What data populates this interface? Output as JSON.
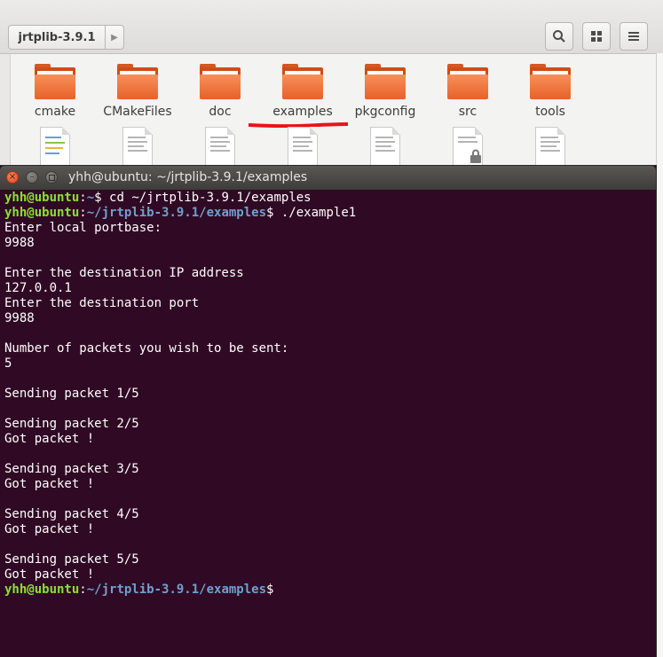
{
  "file_manager": {
    "path_label": "jrtplib-3.9.1",
    "folders": [
      {
        "name": "cmake"
      },
      {
        "name": "CMakeFiles"
      },
      {
        "name": "doc"
      },
      {
        "name": "examples"
      },
      {
        "name": "pkgconfig"
      },
      {
        "name": "src"
      },
      {
        "name": "tools"
      }
    ],
    "annotation_color": "#e8141c",
    "folder_color": "#e8612a"
  },
  "terminal": {
    "title": "yhh@ubuntu: ~/jrtplib-3.9.1/examples",
    "prompt_user": "yhh@ubuntu",
    "lines": [
      {
        "kind": "prompt",
        "path": "~",
        "cmd": " cd ~/jrtplib-3.9.1/examples"
      },
      {
        "kind": "prompt",
        "path": "~/jrtplib-3.9.1/examples",
        "cmd": " ./example1"
      },
      {
        "kind": "text",
        "text": "Enter local portbase:"
      },
      {
        "kind": "text",
        "text": "9988"
      },
      {
        "kind": "text",
        "text": ""
      },
      {
        "kind": "text",
        "text": "Enter the destination IP address"
      },
      {
        "kind": "text",
        "text": "127.0.0.1"
      },
      {
        "kind": "text",
        "text": "Enter the destination port"
      },
      {
        "kind": "text",
        "text": "9988"
      },
      {
        "kind": "text",
        "text": ""
      },
      {
        "kind": "text",
        "text": "Number of packets you wish to be sent:"
      },
      {
        "kind": "text",
        "text": "5"
      },
      {
        "kind": "text",
        "text": ""
      },
      {
        "kind": "text",
        "text": "Sending packet 1/5"
      },
      {
        "kind": "text",
        "text": ""
      },
      {
        "kind": "text",
        "text": "Sending packet 2/5"
      },
      {
        "kind": "text",
        "text": "Got packet !"
      },
      {
        "kind": "text",
        "text": ""
      },
      {
        "kind": "text",
        "text": "Sending packet 3/5"
      },
      {
        "kind": "text",
        "text": "Got packet !"
      },
      {
        "kind": "text",
        "text": ""
      },
      {
        "kind": "text",
        "text": "Sending packet 4/5"
      },
      {
        "kind": "text",
        "text": "Got packet !"
      },
      {
        "kind": "text",
        "text": ""
      },
      {
        "kind": "text",
        "text": "Sending packet 5/5"
      },
      {
        "kind": "text",
        "text": "Got packet !"
      },
      {
        "kind": "prompt",
        "path": "~/jrtplib-3.9.1/examples",
        "cmd": ""
      }
    ]
  }
}
